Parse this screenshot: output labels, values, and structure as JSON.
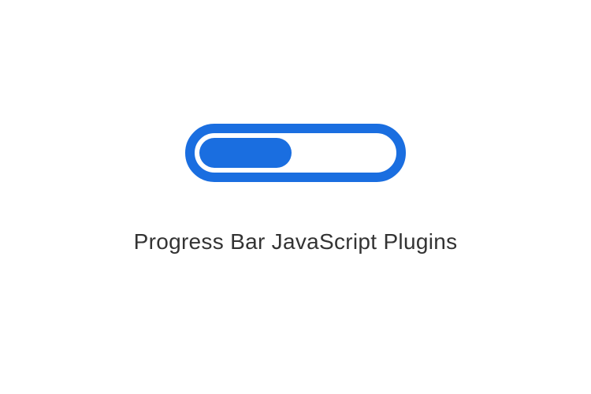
{
  "progress": {
    "percent": 48,
    "color": "#1a6ee0"
  },
  "caption": "Progress Bar JavaScript Plugins"
}
